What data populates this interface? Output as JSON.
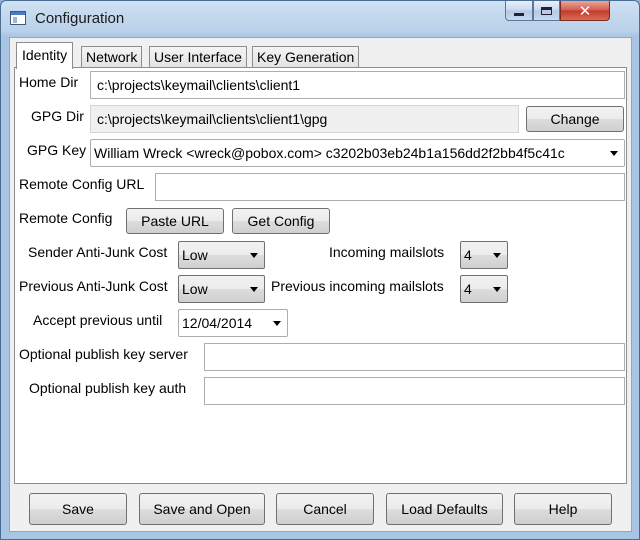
{
  "window": {
    "title": "Configuration"
  },
  "tabs": [
    "Identity",
    "Network",
    "User Interface",
    "Key Generation"
  ],
  "identity": {
    "home_dir_label": "Home Dir",
    "home_dir_value": "c:\\projects\\keymail\\clients\\client1",
    "gpg_dir_label": "GPG Dir",
    "gpg_dir_value": "c:\\projects\\keymail\\clients\\client1\\gpg",
    "change_label": "Change",
    "gpg_key_label": "GPG Key",
    "gpg_key_value": "William Wreck <wreck@pobox.com> c3202b03eb24b1a156dd2f2bb4f5c41c",
    "remote_config_url_label": "Remote Config URL",
    "remote_config_url_value": "",
    "remote_config_label": "Remote Config",
    "paste_url_label": "Paste URL",
    "get_config_label": "Get Config",
    "sender_cost_label": "Sender Anti-Junk Cost",
    "sender_cost_value": "Low",
    "incoming_mailslots_label": "Incoming mailslots",
    "incoming_mailslots_value": "4",
    "previous_cost_label": "Previous Anti-Junk Cost",
    "previous_cost_value": "Low",
    "previous_mailslots_label": "Previous incoming mailslots",
    "previous_mailslots_value": "4",
    "accept_previous_label": "Accept previous until",
    "accept_previous_value": "12/04/2014",
    "publish_server_label": "Optional publish key server",
    "publish_server_value": "",
    "publish_auth_label": "Optional publish key auth",
    "publish_auth_value": ""
  },
  "buttons": {
    "save": "Save",
    "save_open": "Save and Open",
    "cancel": "Cancel",
    "load_defaults": "Load Defaults",
    "help": "Help"
  }
}
